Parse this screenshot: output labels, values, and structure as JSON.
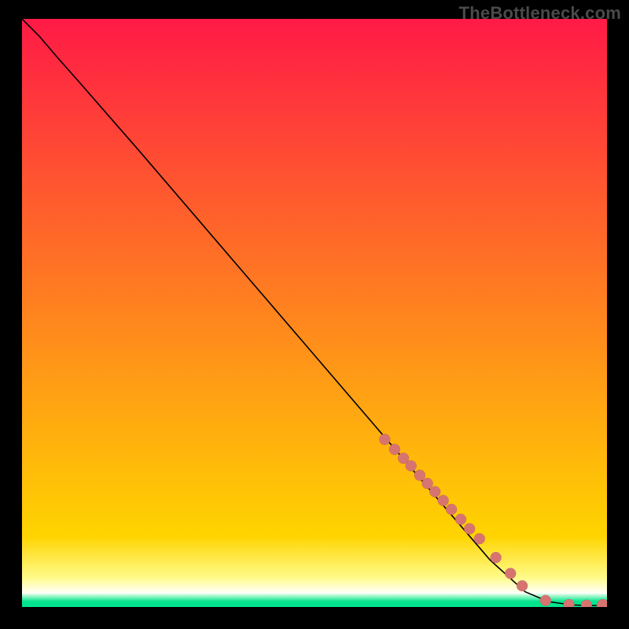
{
  "watermark": "TheBottleneck.com",
  "colors": {
    "marker": "#d87470",
    "curve": "#000000",
    "gradient_top": "#ff1a46",
    "gradient_mid": "#ffd400",
    "gradient_low_yellow": "#fffb8a",
    "gradient_teal": "#00e58e",
    "frame": "#000000"
  },
  "chart_data": {
    "type": "line",
    "title": "",
    "xlabel": "",
    "ylabel": "",
    "xlim": [
      0,
      100
    ],
    "ylim": [
      0,
      100
    ],
    "grid": false,
    "legend": false,
    "series": [
      {
        "name": "curve",
        "x": [
          0,
          3,
          6,
          10,
          20,
          30,
          40,
          50,
          60,
          70,
          80,
          86,
          90,
          94,
          97,
          100
        ],
        "y": [
          100,
          97,
          93.5,
          89,
          77.6,
          66,
          54.4,
          42.8,
          31.2,
          19.6,
          8,
          2.6,
          0.9,
          0.35,
          0.25,
          0.25
        ]
      }
    ],
    "markers": {
      "name": "points",
      "x": [
        62,
        63.7,
        65.2,
        66.5,
        68,
        69.3,
        70.6,
        72,
        73.4,
        75,
        76.5,
        78.2,
        81,
        83.5,
        85.5,
        89.5,
        93.5,
        96.5,
        99.3
      ],
      "y": [
        28.5,
        26.8,
        25.3,
        24,
        22.4,
        21,
        19.6,
        18.1,
        16.6,
        14.9,
        13.3,
        11.6,
        8.4,
        5.7,
        3.6,
        1.1,
        0.4,
        0.3,
        0.27
      ],
      "r": [
        7,
        7,
        7,
        7,
        7,
        7,
        7,
        7,
        7,
        7,
        7,
        7,
        7,
        7,
        7,
        7,
        7,
        7,
        8
      ]
    },
    "background_bands": [
      {
        "from_y": 100,
        "to_y": 12,
        "gradient": [
          "#ff1a46",
          "#ffd400"
        ]
      },
      {
        "from_y": 12,
        "to_y": 5,
        "gradient": [
          "#ffd400",
          "#fffb8a"
        ]
      },
      {
        "from_y": 5,
        "to_y": 2.3,
        "gradient": [
          "#fffb8a",
          "#ffffff"
        ]
      },
      {
        "from_y": 2.3,
        "to_y": 1.0,
        "gradient": [
          "#e8ffe8",
          "#00e58e"
        ]
      },
      {
        "from_y": 1.0,
        "to_y": 0,
        "solid": "#00e58e"
      }
    ]
  }
}
